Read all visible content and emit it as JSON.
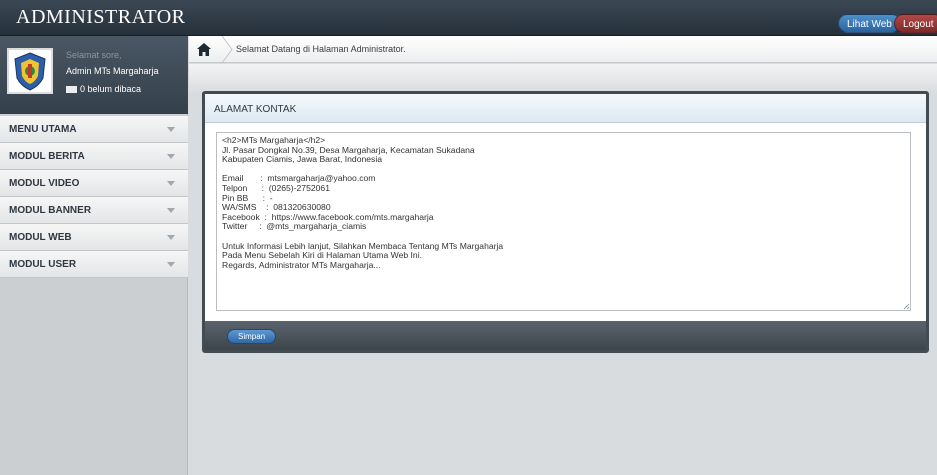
{
  "header": {
    "title": "ADMINISTRATOR",
    "view_site_label": "Lihat Web",
    "logout_label": "Logout"
  },
  "user": {
    "greeting": "Selamat sore,",
    "name": "Admin MTs Margaharja",
    "unread": "0 belum dibaca"
  },
  "menu": [
    {
      "label": "MENU UTAMA"
    },
    {
      "label": "MODUL BERITA"
    },
    {
      "label": "MODUL VIDEO"
    },
    {
      "label": "MODUL BANNER"
    },
    {
      "label": "MODUL WEB"
    },
    {
      "label": "MODUL USER"
    }
  ],
  "breadcrumb": {
    "text": "Selamat Datang di Halaman Administrator."
  },
  "panel": {
    "title": "ALAMAT KONTAK",
    "content": "<h2>MTs Margaharja</h2>\nJl. Pasar Dongkal No.39, Desa Margaharja, Kecamatan Sukadana\nKabupaten Ciamis, Jawa Barat, Indonesia\n\nEmail       :  mtsmargaharja@yahoo.com\nTelpon      :  (0265)-2752061\nPin BB      :  -\nWA/SMS    :  081320630080\nFacebook  :  https://www.facebook.com/mts.margaharja\nTwitter     :  @mts_margaharja_ciamis\n\nUntuk Informasi Lebih lanjut, Silahkan Membaca Tentang MTs Margaharja\nPada Menu Sebelah Kiri di Halaman Utama Web Ini.\nRegards, Administrator MTs Margaharja...",
    "save_label": "Simpan"
  },
  "colors": {
    "header_bg": "#2f3a45",
    "accent_blue": "#3a78b8",
    "logout_red": "#8e3333"
  }
}
